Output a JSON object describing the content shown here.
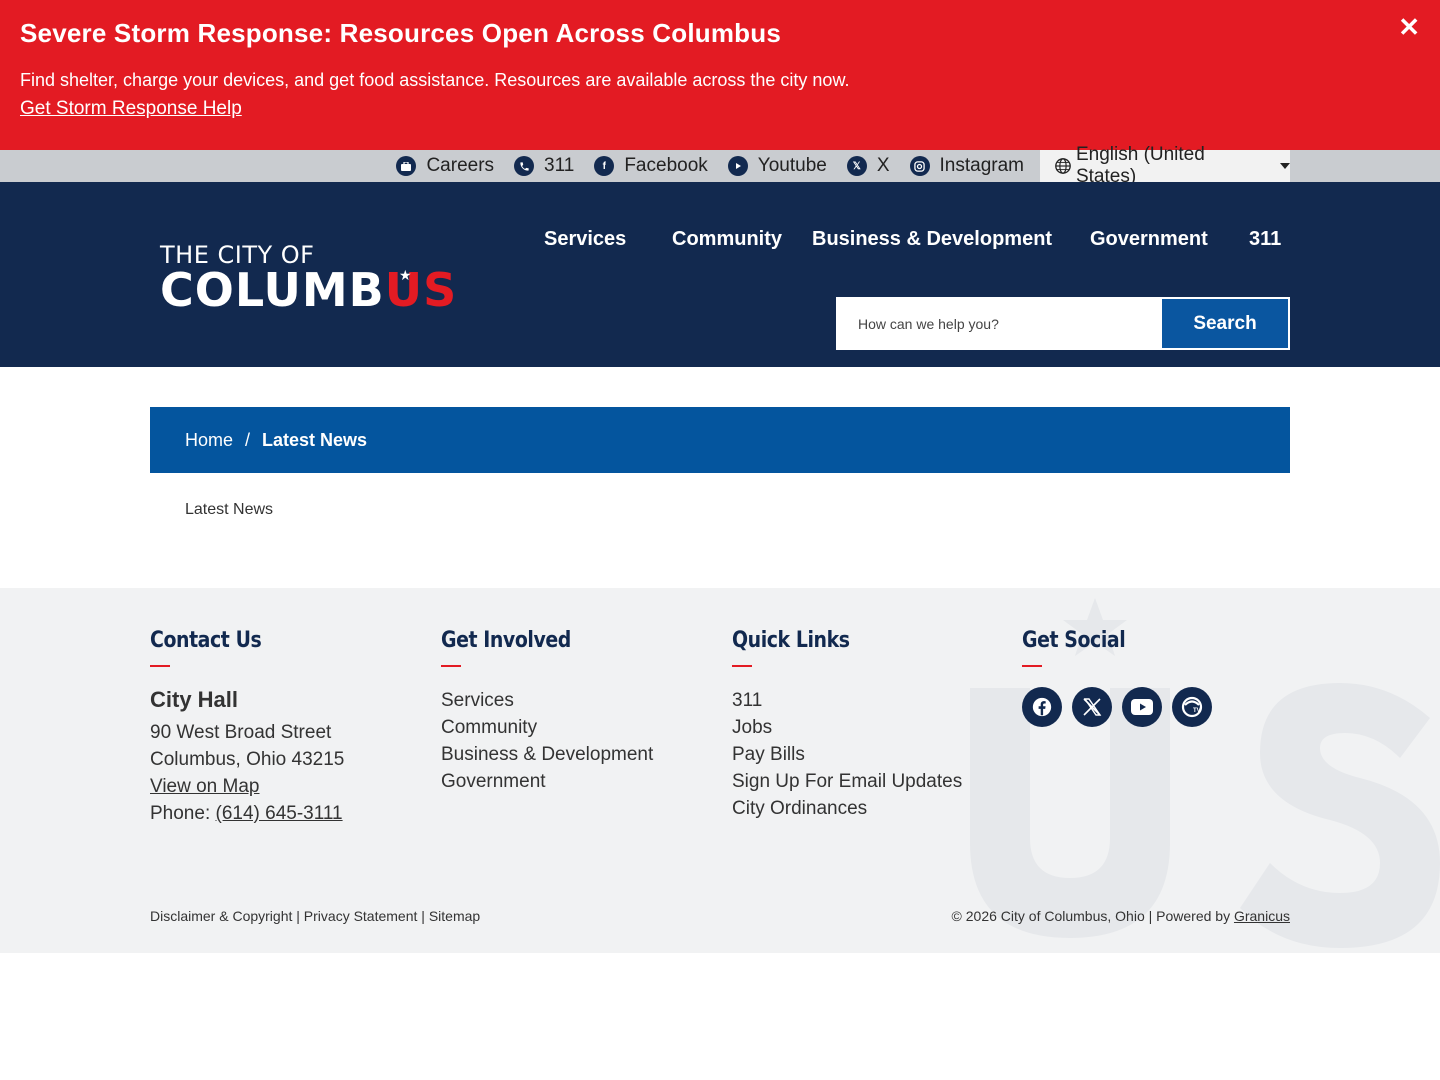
{
  "alert": {
    "title": "Severe Storm Response: Resources Open Across Columbus",
    "text": "Find shelter, charge your devices, and get food assistance. Resources are available across the city now.",
    "link": "Get Storm Response Help",
    "close": "✕"
  },
  "utility": {
    "links": [
      {
        "label": "Careers",
        "icon": "briefcase-icon"
      },
      {
        "label": "311",
        "icon": "phone-icon"
      },
      {
        "label": "Facebook",
        "icon": "facebook-icon"
      },
      {
        "label": "Youtube",
        "icon": "youtube-icon"
      },
      {
        "label": "X",
        "icon": "x-icon"
      },
      {
        "label": "Instagram",
        "icon": "instagram-icon"
      }
    ],
    "language": "English (United States)"
  },
  "header": {
    "logo_line1": "THE CITY OF",
    "logo_main": "COLUMB",
    "logo_accent": "US",
    "nav": [
      "Services",
      "Community",
      "Business & Development",
      "Government",
      "311"
    ],
    "search_placeholder": "How can we help you?",
    "search_button": "Search"
  },
  "breadcrumb": {
    "home": "Home",
    "separator": "/",
    "current": "Latest News"
  },
  "page": {
    "title": "Latest News"
  },
  "footer": {
    "contact": {
      "title": "Contact Us",
      "name": "City Hall",
      "address1": "90 West Broad Street",
      "address2": "Columbus, Ohio 43215",
      "map_link": "View on Map",
      "phone_label": "Phone: ",
      "phone": "(614) 645-3111"
    },
    "get_involved": {
      "title": "Get Involved",
      "links": [
        "Services",
        "Community",
        "Business & Development",
        "Government"
      ]
    },
    "quick_links": {
      "title": "Quick Links",
      "links": [
        "311",
        "Jobs",
        "Pay Bills",
        "Sign Up For Email Updates",
        "City Ordinances"
      ]
    },
    "social": {
      "title": "Get Social",
      "icons": [
        "facebook-icon",
        "x-icon",
        "youtube-icon",
        "cctv-icon"
      ]
    },
    "bottom_left": [
      "Disclaimer & Copyright",
      "Privacy Statement",
      "Sitemap"
    ],
    "bottom_sep": " | ",
    "copyright": "© 2026 City of Columbus, Ohio | Powered by ",
    "powered_by": "Granicus"
  },
  "colors": {
    "alert_red": "#e31b23",
    "navy": "#12294f",
    "breadcrumb_blue": "#04559e",
    "search_blue": "#0a56a0"
  }
}
